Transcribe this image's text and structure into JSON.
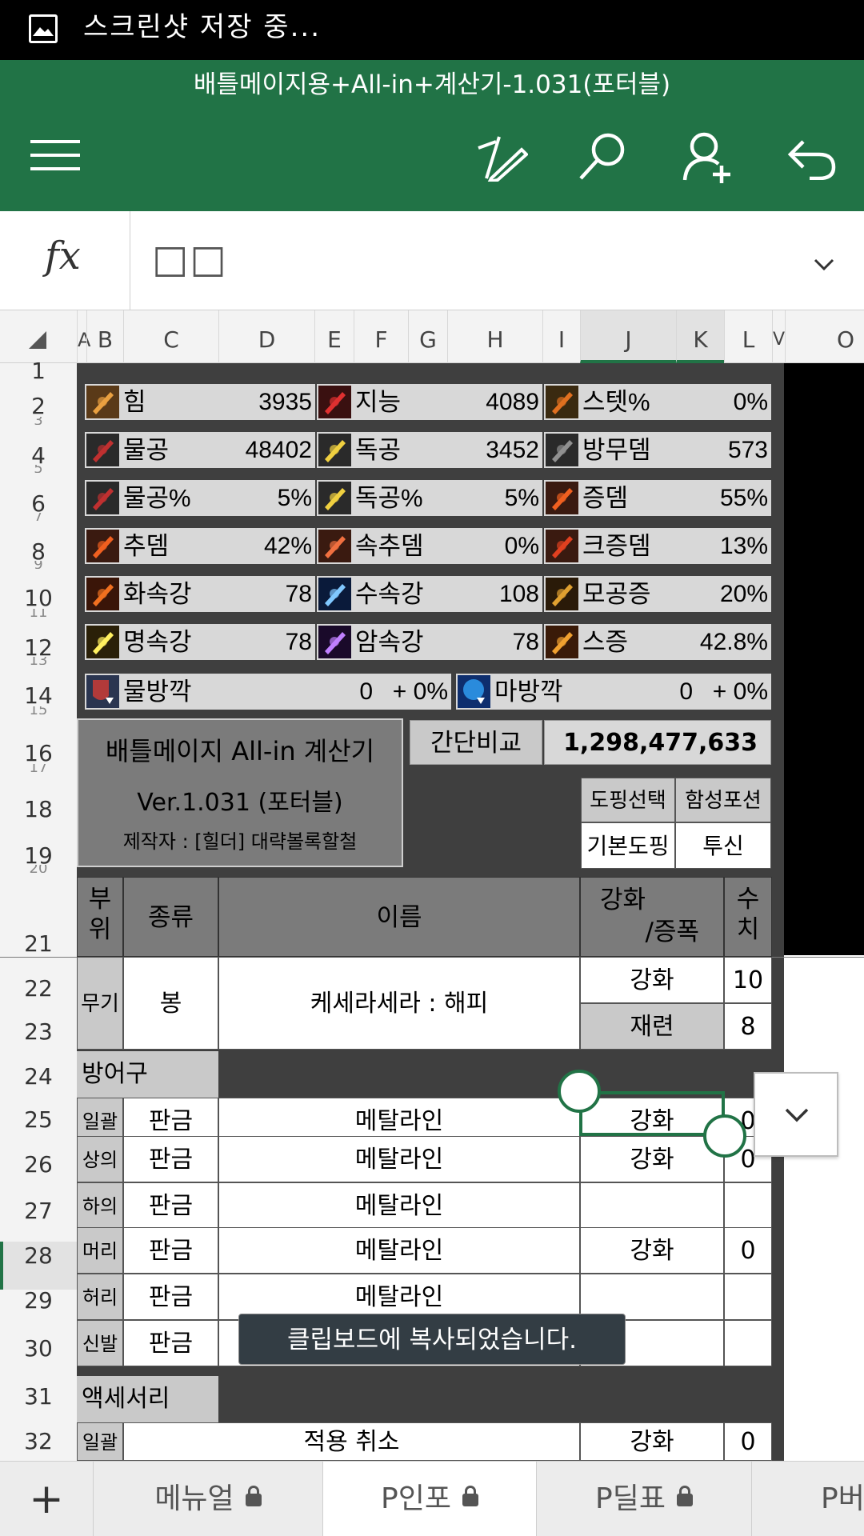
{
  "status_bar": {
    "text": "스크린샷 저장 중..."
  },
  "title": "배틀메이지용+All-in+계산기-1.031(포터블)",
  "formula_bar": {
    "fx": "fx",
    "content": "□□"
  },
  "columns": [
    "A",
    "B",
    "C",
    "D",
    "E",
    "F",
    "G",
    "H",
    "I",
    "J",
    "K",
    "L",
    "V",
    "O"
  ],
  "rows": [
    "1",
    "2",
    "3",
    "4",
    "5",
    "6",
    "7",
    "8",
    "9",
    "10",
    "11",
    "12",
    "13",
    "14",
    "15",
    "16",
    "17",
    "18",
    "19",
    "20",
    "21",
    "22",
    "23",
    "24",
    "25",
    "26",
    "27",
    "28",
    "29",
    "30",
    "31",
    "32"
  ],
  "stats": [
    [
      {
        "label": "힘",
        "value": "3935",
        "icon": "strength-icon"
      },
      {
        "label": "지능",
        "value": "4089",
        "icon": "intelligence-icon"
      },
      {
        "label": "스텟%",
        "value": "0%",
        "icon": "stat-percent-icon"
      }
    ],
    [
      {
        "label": "물공",
        "value": "48402",
        "icon": "physical-attack-icon"
      },
      {
        "label": "독공",
        "value": "3452",
        "icon": "independent-attack-icon"
      },
      {
        "label": "방무뎀",
        "value": "573",
        "icon": "armor-ignore-icon"
      }
    ],
    [
      {
        "label": "물공%",
        "value": "5%",
        "icon": "physical-attack-percent-icon"
      },
      {
        "label": "독공%",
        "value": "5%",
        "icon": "independent-attack-percent-icon"
      },
      {
        "label": "증뎀",
        "value": "55%",
        "icon": "damage-increase-icon"
      }
    ],
    [
      {
        "label": "추뎀",
        "value": "42%",
        "icon": "additional-damage-icon"
      },
      {
        "label": "속추뎀",
        "value": "0%",
        "icon": "elemental-additional-damage-icon"
      },
      {
        "label": "크증뎀",
        "value": "13%",
        "icon": "critical-damage-icon"
      }
    ],
    [
      {
        "label": "화속강",
        "value": "78",
        "icon": "fire-element-icon"
      },
      {
        "label": "수속강",
        "value": "108",
        "icon": "water-element-icon"
      },
      {
        "label": "모공증",
        "value": "20%",
        "icon": "all-attack-icon"
      }
    ],
    [
      {
        "label": "명속강",
        "value": "78",
        "icon": "light-element-icon"
      },
      {
        "label": "암속강",
        "value": "78",
        "icon": "dark-element-icon"
      },
      {
        "label": "스증",
        "value": "42.8%",
        "icon": "skill-damage-icon"
      }
    ]
  ],
  "defense_reduce": [
    {
      "label": "물방깍",
      "value": "0",
      "pct": "+ 0%",
      "icon": "physical-defense-reduce-icon"
    },
    {
      "label": "마방깍",
      "value": "0",
      "pct": "+ 0%",
      "icon": "magic-defense-reduce-icon"
    }
  ],
  "calc_box": {
    "title": "배틀메이지 All-in 계산기",
    "version": "Ver.1.031 (포터블)",
    "author": "제작자 : [힐더] 대략볼록할철"
  },
  "simple_compare": {
    "label": "간단비교",
    "value": "1,298,477,633"
  },
  "doping": {
    "h1": "도핑선택",
    "h2": "함성포션",
    "v1": "기본도핑",
    "v2": "투신"
  },
  "table_header": {
    "slot_a": "부",
    "slot_b": "위",
    "type": "종류",
    "name": "이름",
    "enhance_a": "강화",
    "enhance_b": "/증폭",
    "value_a": "수",
    "value_b": "치"
  },
  "weapon": {
    "slot": "무기",
    "type": "봉",
    "name": "케세라세라 : 해피",
    "enhance1": "강화",
    "value1": "10",
    "enhance2": "재련",
    "value2": "8"
  },
  "armor_section": "방어구",
  "armor": [
    {
      "slot": "일괄",
      "type": "판금",
      "name": "메탈라인",
      "enhance": "강화",
      "value": "0"
    },
    {
      "slot": "상의",
      "type": "판금",
      "name": "메탈라인",
      "enhance": "강화",
      "value": "0"
    },
    {
      "slot": "하의",
      "type": "판금",
      "name": "메탈라인",
      "enhance": "",
      "value": ""
    },
    {
      "slot": "머리",
      "type": "판금",
      "name": "메탈라인",
      "enhance": "강화",
      "value": "0"
    },
    {
      "slot": "허리",
      "type": "판금",
      "name": "메탈라인",
      "enhance": "",
      "value": ""
    },
    {
      "slot": "신발",
      "type": "판금",
      "name": "",
      "enhance": "",
      "value": ""
    }
  ],
  "accessory_section": "액세서리",
  "accessory": {
    "slot": "일괄",
    "name": "적용 취소",
    "enhance": "강화",
    "value": "0"
  },
  "toast": "클립보드에 복사되었습니다.",
  "tabs": [
    {
      "label": "메뉴얼"
    },
    {
      "label": "P인포"
    },
    {
      "label": "P딜표"
    },
    {
      "label": "P버"
    }
  ],
  "colors": {
    "excel_green": "#217346",
    "sheet_dark": "#3f3f3f",
    "stat_bg": "#d8d8d8",
    "header_gray": "#7b7b7b"
  }
}
